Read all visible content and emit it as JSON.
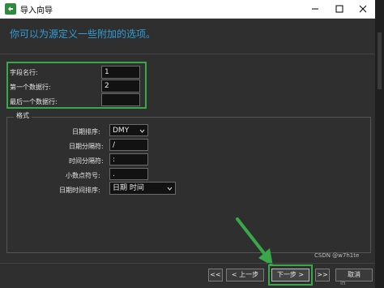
{
  "window": {
    "title": "导入向导",
    "prompt": "你可以为源定义一些附加的选项。"
  },
  "rows": {
    "field_name_row_label": "字段名行:",
    "field_name_row_value": "1",
    "first_data_row_label": "第一个数据行:",
    "first_data_row_value": "2",
    "last_data_row_label": "最后一个数据行:",
    "last_data_row_value": ""
  },
  "format": {
    "group_title": "格式",
    "date_order_label": "日期排序:",
    "date_order_value": "DMY",
    "date_sep_label": "日期分隔符:",
    "date_sep_value": "/",
    "time_sep_label": "时间分隔符:",
    "time_sep_value": ":",
    "decimal_label": "小数点符号:",
    "decimal_value": ".",
    "datetime_order_label": "日期时间排序:",
    "datetime_order_value": "日期 时间"
  },
  "footer": {
    "first_label": "<<",
    "prev_label": "< 上一步",
    "next_label": "下一步 >",
    "last_label": ">>",
    "cancel_label": "取消"
  },
  "watermark": "CSDN @w7h1te",
  "watermark2": "in"
}
